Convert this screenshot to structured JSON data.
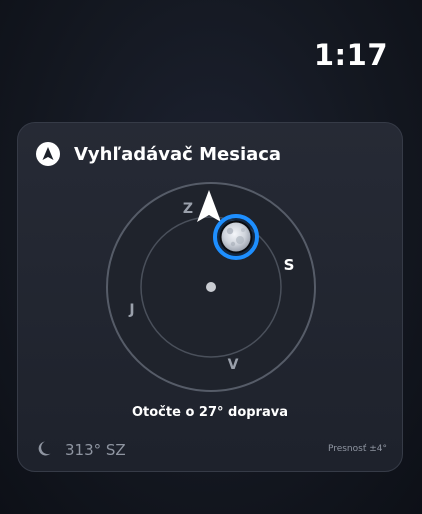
{
  "status_bar": {
    "time": "1:17"
  },
  "widget": {
    "title": "Vyhľadávač Mesiaca",
    "app_icon": "navigation-arrow-icon",
    "compass": {
      "labels": {
        "north": "S",
        "east": "V",
        "south": "J",
        "west": "Z"
      },
      "moon_icon": "full-moon-icon",
      "pointer_icon": "direction-arrow-icon",
      "accent_color": "#1e8fff"
    },
    "instruction": "Otočte o 27° doprava",
    "heading_icon": "crescent-moon-icon",
    "heading": "313° SZ",
    "accuracy": "Presnosť ±4°"
  }
}
